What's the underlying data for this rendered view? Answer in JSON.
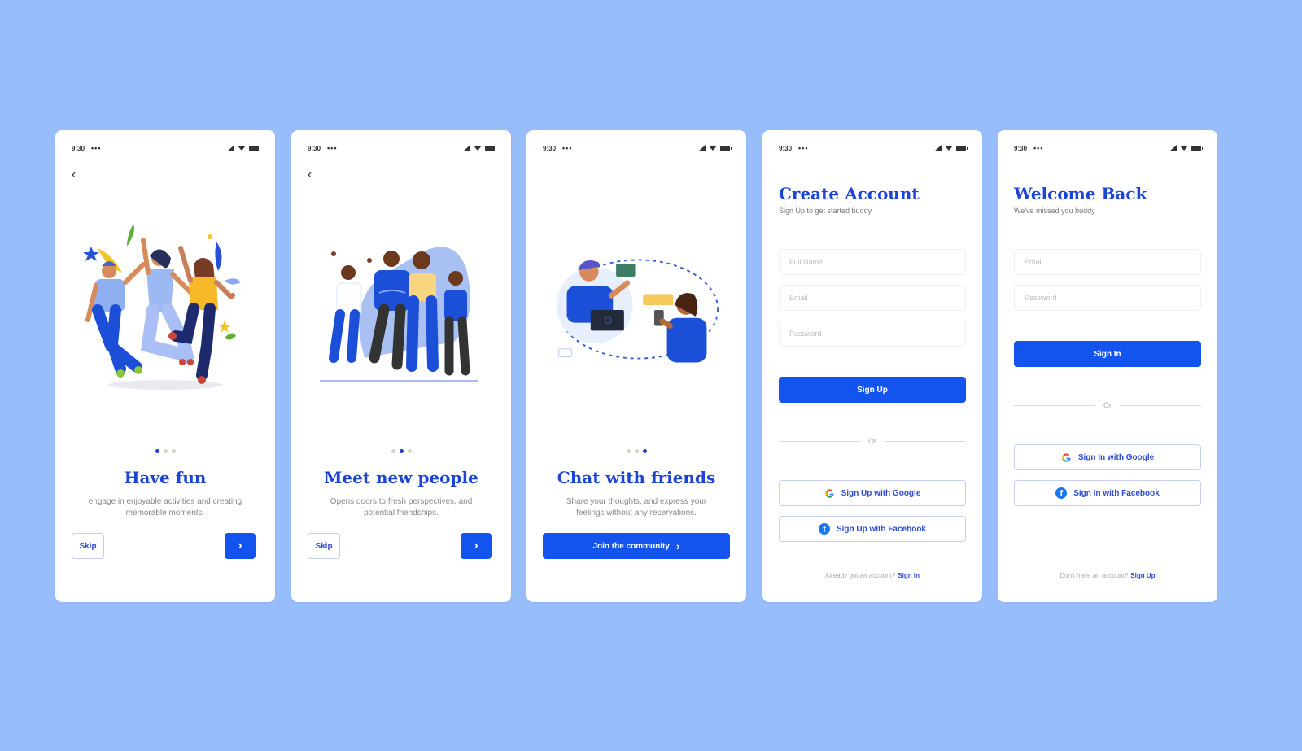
{
  "colors": {
    "background": "#98bdfb",
    "primary": "#1354ee",
    "title": "#1c45d6",
    "facebook": "#1877f2"
  },
  "status_bar": {
    "time": "9:30",
    "more": "•••",
    "icons": [
      "signal-icon",
      "wifi-icon",
      "battery-icon"
    ]
  },
  "screens": {
    "onboarding1": {
      "back_icon": "‹",
      "illustration": "friends-jumping-celebration",
      "pager_active": 0,
      "pager_total": 3,
      "title": "Have fun",
      "description": "engage in enjoyable activities and creating memorable moments.",
      "skip_label": "Skip",
      "next_icon": "›"
    },
    "onboarding2": {
      "back_icon": "‹",
      "illustration": "group-of-friends-hugging",
      "pager_active": 1,
      "pager_total": 3,
      "title": "Meet new people",
      "description": "Opens doors to fresh perspectives, and potential friendships.",
      "skip_label": "Skip",
      "next_icon": "›"
    },
    "onboarding3": {
      "illustration": "two-people-chatting-online",
      "pager_active": 2,
      "pager_total": 3,
      "title": "Chat with friends",
      "description": "Share your thoughts, and express your feelings without any reservations.",
      "join_label": "Join the community",
      "join_icon": "›"
    },
    "signup": {
      "title": "Create Account",
      "subtitle": "Sign Up to get started buddy",
      "fields": [
        {
          "placeholder": "Full Name",
          "value": ""
        },
        {
          "placeholder": "Email",
          "value": ""
        },
        {
          "placeholder": "Password",
          "value": ""
        }
      ],
      "submit_label": "Sign Up",
      "or_label": "Or",
      "google_label": "Sign Up with Google",
      "facebook_label": "Sign Up with Facebook",
      "footer_text": "Already got an account?",
      "footer_link": "Sign In"
    },
    "signin": {
      "title": "Welcome Back",
      "subtitle": "We've missed you buddy",
      "fields": [
        {
          "placeholder": "Email",
          "value": ""
        },
        {
          "placeholder": "Password",
          "value": ""
        }
      ],
      "submit_label": "Sign In",
      "or_label": "Or",
      "google_label": "Sign In with Google",
      "facebook_label": "Sign In with Facebook",
      "footer_text": "Don't have an account?",
      "footer_link": "Sign Up"
    }
  }
}
